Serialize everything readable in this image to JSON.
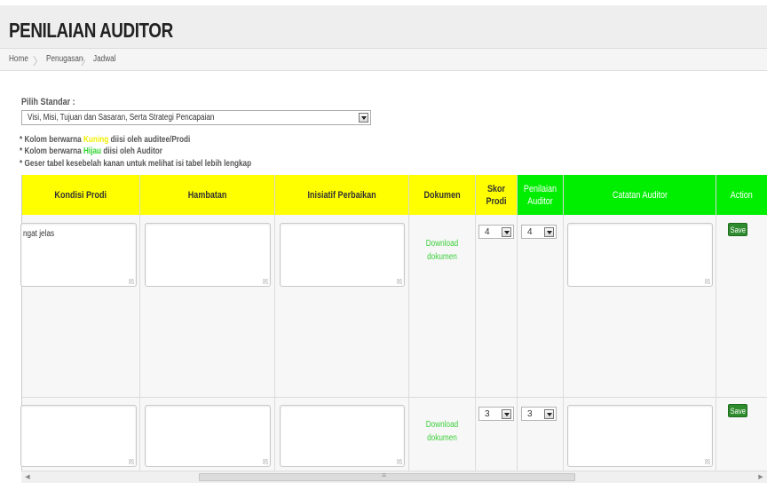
{
  "page": {
    "title": "PENILAIAN AUDITOR"
  },
  "breadcrumb": {
    "items": [
      "Home",
      "Penugasan",
      "Jadwal"
    ]
  },
  "standar": {
    "label": "Pilih Standar :",
    "selected": "Visi, Misi, Tujuan dan Sasaran, Serta Strategi Pencapaian"
  },
  "notes": {
    "n1_prefix": "* Kolom berwarna ",
    "n1_color": "Kuning",
    "n1_suffix": " diisi oleh auditee/Prodi",
    "n2_prefix": "* Kolom berwarna ",
    "n2_color": "Hijau",
    "n2_suffix": " diisi oleh Auditor",
    "n3": "* Geser tabel kesebelah kanan untuk melihat isi tabel lebih lengkap"
  },
  "table": {
    "headers": {
      "kondisi": "Kondisi Prodi",
      "hambatan": "Hambatan",
      "inisiatif": "Inisiatif Perbaikan",
      "dokumen": "Dokumen",
      "skor": "Skor Prodi",
      "penilaian": "Penilaian Auditor",
      "catatan": "Catatan Auditor",
      "action": "Action"
    },
    "rows": [
      {
        "kondisi_text": "ngat jelas",
        "dokumen": "Download dokumen",
        "skor": "4",
        "penilaian": "4",
        "save": "Save"
      },
      {
        "kondisi_text": "",
        "dokumen": "Download dokumen",
        "skor": "3",
        "penilaian": "3",
        "save": "Save"
      }
    ]
  },
  "colors": {
    "yellow": "#ffff00",
    "green": "#00ee00",
    "save": "#2e8b2e",
    "link": "#3ccf3c"
  },
  "icons": [
    "chevron-right-icon",
    "dropdown-arrow-icon",
    "resize-grip-icon",
    "scroll-left-icon",
    "scroll-right-icon"
  ]
}
